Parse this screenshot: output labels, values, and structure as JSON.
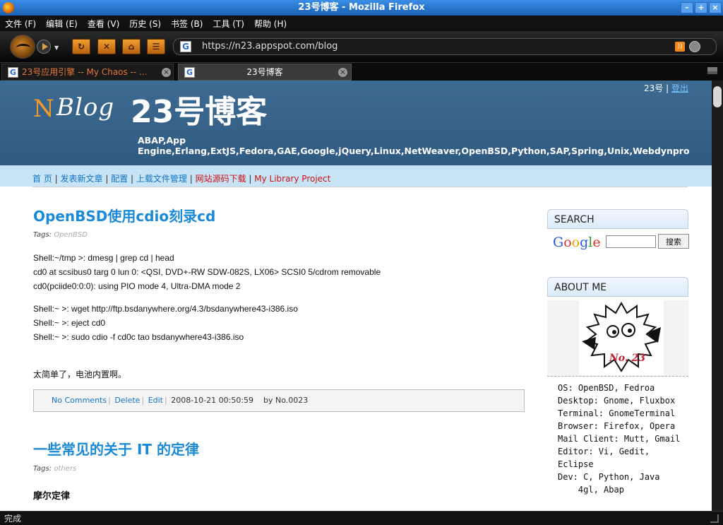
{
  "window": {
    "title": "23号博客 - Mozilla Firefox",
    "min": "–",
    "max": "+",
    "close": "×"
  },
  "menu": [
    "文件 (F)",
    "编辑 (E)",
    "查看 (V)",
    "历史 (S)",
    "书签 (B)",
    "工具 (T)",
    "帮助 (H)"
  ],
  "url": "https://n23.appspot.com/blog",
  "tabs": [
    {
      "label": "23号应用引擎 -- My Chaos -- ..."
    },
    {
      "label": "23号博客"
    }
  ],
  "header": {
    "logo_n": "N",
    "logo_blog": "Blog",
    "title": "23号博客",
    "tags": "ABAP,App Engine,Erlang,ExtJS,Fedora,GAE,Google,jQuery,Linux,NetWeaver,OpenBSD,Python,SAP,Spring,Unix,Webdynpro",
    "user": "23号",
    "logout": "登出"
  },
  "nav": {
    "home": "首 页",
    "new_post": "发表新文章",
    "config": "配置",
    "upload": "上载文件管理",
    "source": "网站源码下载",
    "library": "My Library Project"
  },
  "post1": {
    "title": "OpenBSD使用cdio刻录cd",
    "tags_label": "Tags:",
    "tag": "OpenBSD",
    "lines": [
      "Shell:~/tmp >: dmesg | grep cd | head",
      "cd0 at scsibus0 targ 0 lun 0: <QSI, DVD+-RW SDW-082S, LX06> SCSI0 5/cdrom removable",
      "cd0(pciide0:0:0): using PIO mode 4, Ultra-DMA mode 2",
      "Shell:~ >: wget http://ftp.bsdanywhere.org/4.3/bsdanywhere43-i386.iso",
      "Shell:~ >: eject cd0",
      "Shell:~ >: sudo cdio -f cd0c tao bsdanywhere43-i386.iso",
      "太简单了，电池内置啊。"
    ],
    "meta": {
      "comments": "No Comments",
      "delete": "Delete",
      "edit": "Edit",
      "date": "2008-10-21  00:50:59",
      "author": "by No.0023"
    }
  },
  "post2": {
    "title": "一些常见的关于 IT 的定律",
    "tags_label": "Tags:",
    "tag": "others",
    "subheading": "摩尔定律"
  },
  "sidebar": {
    "search_title": "SEARCH",
    "google": "Google",
    "search_button": "搜索",
    "search_value": "",
    "about_title": "ABOUT ME",
    "avatar_text": "No. 23",
    "about_lines": "OS: OpenBSD, Fedroa\nDesktop: Gnome, Fluxbox\nTerminal: GnomeTerminal\nBrowser: Firefox, Opera\nMail Client: Mutt, Gmail\nEditor: Vi, Gedit,\nEclipse\nDev: C, Python, Java\n    4gl, Abap"
  },
  "status": "完成"
}
